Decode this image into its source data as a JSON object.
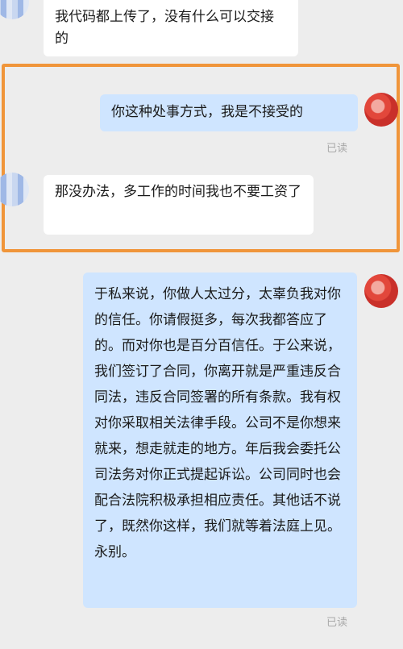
{
  "messages": [
    {
      "side": "left",
      "text": "我代码都上传了，没有什么可以交接的"
    },
    {
      "side": "right",
      "text": "你这种处事方式，我是不接受的",
      "status": "已读"
    },
    {
      "side": "left",
      "text": "那没办法，多工作的时间我也不要工资了"
    },
    {
      "side": "right",
      "text": "于私来说，你做人太过分，太辜负我对你的信任。你请假挺多，每次我都答应了的。而对你也是百分百信任。于公来说，我们签订了合同，你离开就是严重违反合同法，违反合同签署的所有条款。我有权对你采取相关法律手段。公司不是你想来就来，想走就走的地方。年后我会委托公司法务对你正式提起诉讼。公司同时也会配合法院积极承担相应责任。其他话不说了，既然你这样，我们就等着法庭上见。永别。",
      "status": "已读"
    }
  ],
  "colors": {
    "highlight": "#f0953a",
    "outgoing_bubble": "#cfe5ff",
    "incoming_bubble": "#ffffff"
  }
}
